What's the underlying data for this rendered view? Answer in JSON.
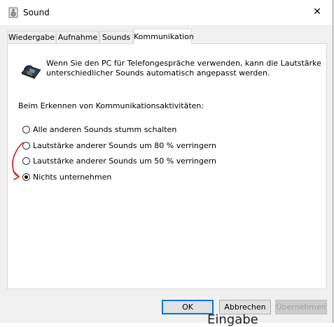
{
  "window": {
    "title": "Sound",
    "close_glyph": "✕",
    "app_icon": "speaker-icon"
  },
  "tabs": [
    {
      "label": "Wiedergabe",
      "active": false
    },
    {
      "label": "Aufnahme",
      "active": false
    },
    {
      "label": "Sounds",
      "active": false
    },
    {
      "label": "Kommunikation",
      "active": true
    }
  ],
  "panel": {
    "intro_text": "Wenn Sie den PC für Telefongespräche verwenden, kann die Lautstärke unterschiedlicher Sounds automatisch angepasst werden.",
    "intro_icon": "telephone-icon",
    "group_label": "Beim Erkennen von Kommunikationsaktivitäten:",
    "options": [
      {
        "label": "Alle anderen Sounds stumm schalten",
        "checked": false
      },
      {
        "label": "Lautstärke anderer Sounds um 80 % verringern",
        "checked": false
      },
      {
        "label": "Lautstärke anderer Sounds um 50 % verringern",
        "checked": false
      },
      {
        "label": "Nichts unternehmen",
        "checked": true
      }
    ]
  },
  "buttons": {
    "ok": "OK",
    "cancel": "Abbrechen",
    "apply": "Übernehmen"
  },
  "background_fragment": "Eingabe",
  "colors": {
    "accent": "#0078d7",
    "annotation": "#e00000"
  }
}
